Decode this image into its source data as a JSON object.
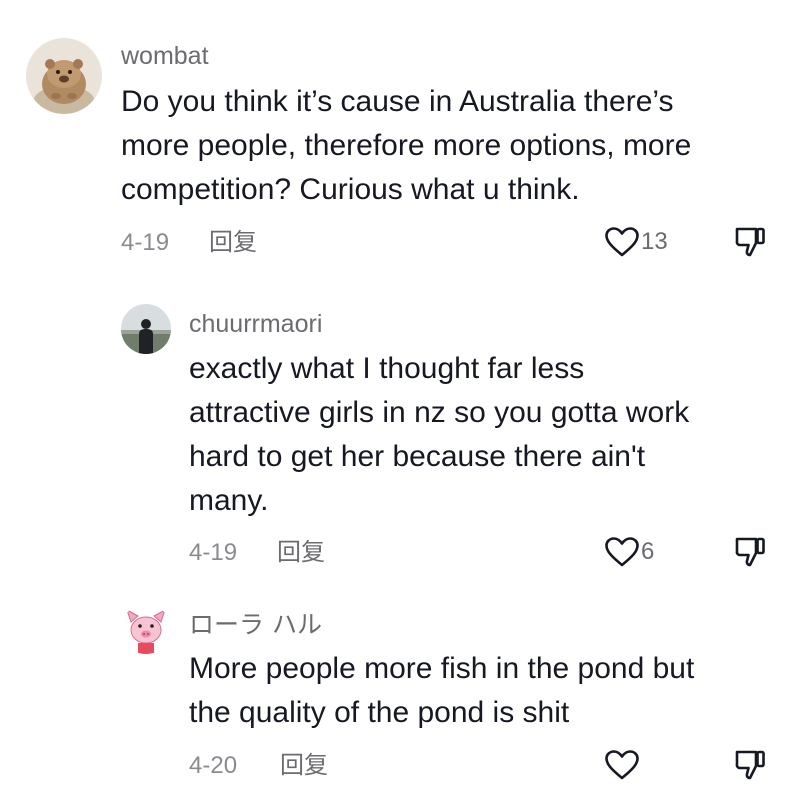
{
  "comments": [
    {
      "username": "wombat",
      "lines": [
        "Do you think it’s cause in Australia there’s",
        "more people, therefore more options, more",
        "competition? Curious what u think."
      ],
      "date": "4-19",
      "reply_label": "回复",
      "likes": "13",
      "avatar_icon": "wombat-avatar"
    },
    {
      "username": "chuurrmaori",
      "lines": [
        "exactly what I thought far less",
        "attractive girls in nz so you gotta work",
        "hard to get her because there ain't",
        "many."
      ],
      "date": "4-19",
      "reply_label": "回复",
      "likes": "6",
      "avatar_icon": "person-silhouette-avatar"
    },
    {
      "username": "ローラ ハル",
      "lines": [
        "More people more fish in the pond but",
        "the quality of the pond is shit"
      ],
      "date": "4-20",
      "reply_label": "回复",
      "likes": "",
      "avatar_icon": "cartoon-pig-avatar"
    }
  ],
  "colors": {
    "text": "#161823",
    "username": "#6b6b70",
    "meta": "#8a8b91"
  }
}
